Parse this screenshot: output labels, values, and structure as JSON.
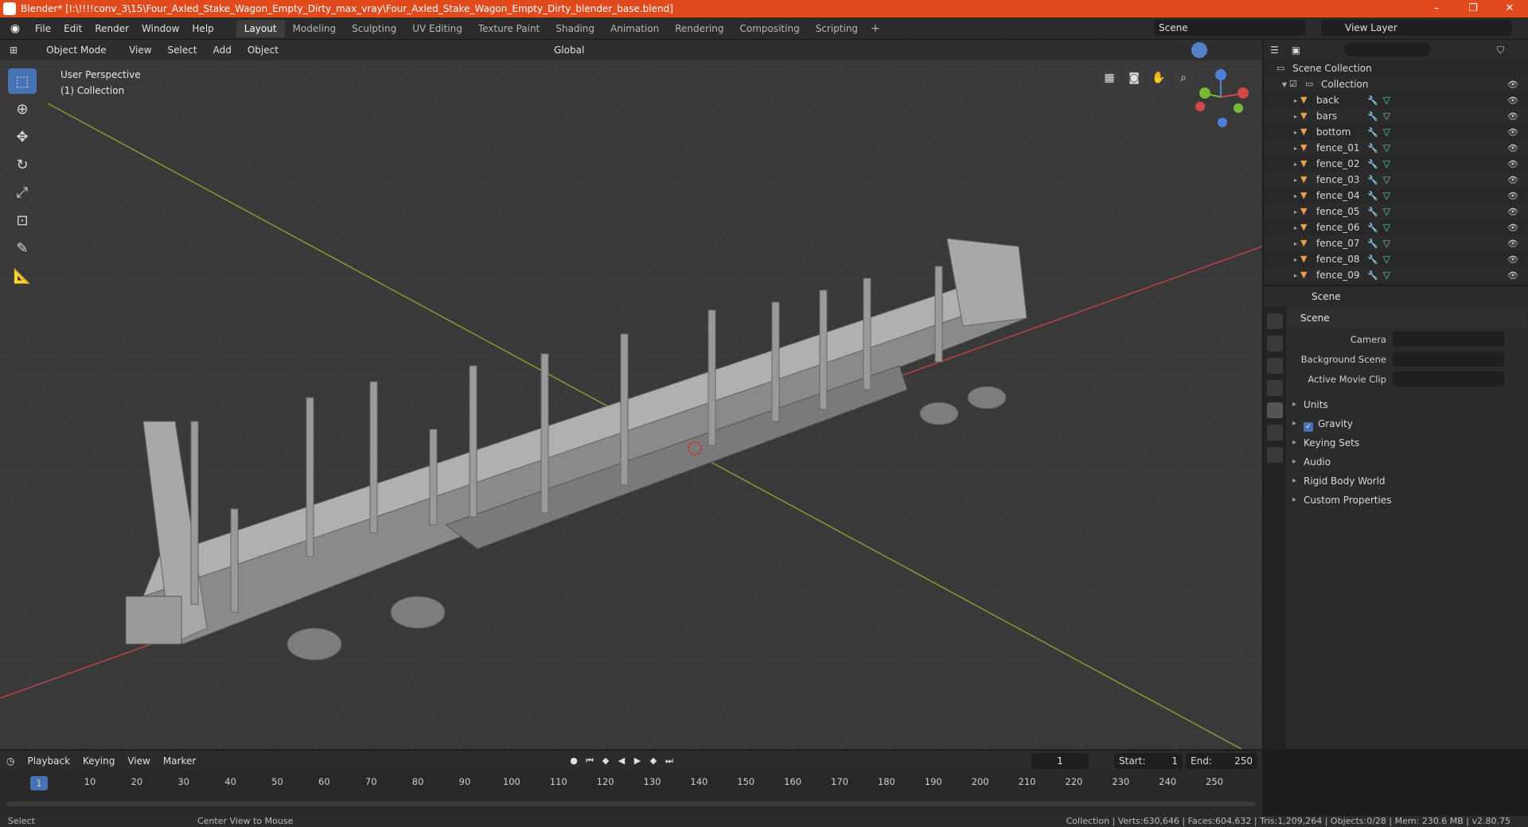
{
  "window": {
    "title": "Blender* [I:\\!!!!conv_3\\15\\Four_Axled_Stake_Wagon_Empty_Dirty_max_vray\\Four_Axled_Stake_Wagon_Empty_Dirty_blender_base.blend]",
    "minimize": "–",
    "maximize": "❐",
    "close": "✕"
  },
  "menu": [
    "File",
    "Edit",
    "Render",
    "Window",
    "Help"
  ],
  "workspaces": [
    "Layout",
    "Modeling",
    "Sculpting",
    "UV Editing",
    "Texture Paint",
    "Shading",
    "Animation",
    "Rendering",
    "Compositing",
    "Scripting"
  ],
  "active_workspace": "Layout",
  "scene_name": "Scene",
  "view_layer": "View Layer",
  "viewport": {
    "mode": "Object Mode",
    "menus": [
      "View",
      "Select",
      "Add",
      "Object"
    ],
    "orientation": "Global",
    "perspective": "User Perspective",
    "collection": "(1) Collection"
  },
  "outliner": {
    "root": "Scene Collection",
    "collection": "Collection",
    "items": [
      "back",
      "bars",
      "bottom",
      "fence_01",
      "fence_02",
      "fence_03",
      "fence_04",
      "fence_05",
      "fence_06",
      "fence_07",
      "fence_08",
      "fence_09"
    ]
  },
  "properties": {
    "header": "Scene",
    "panel": "Scene",
    "fields": [
      {
        "label": "Camera"
      },
      {
        "label": "Background Scene"
      },
      {
        "label": "Active Movie Clip"
      }
    ],
    "subpanels": [
      "Units",
      "Gravity",
      "Keying Sets",
      "Audio",
      "Rigid Body World",
      "Custom Properties"
    ],
    "gravity_checked": true
  },
  "timeline": {
    "menus": [
      "Playback",
      "Keying",
      "View",
      "Marker"
    ],
    "current_frame": "1",
    "start_label": "Start:",
    "start": "1",
    "end_label": "End:",
    "end": "250",
    "ticks": [
      "1",
      "10",
      "20",
      "30",
      "40",
      "50",
      "60",
      "70",
      "80",
      "90",
      "100",
      "110",
      "120",
      "130",
      "140",
      "150",
      "160",
      "170",
      "180",
      "190",
      "200",
      "210",
      "220",
      "230",
      "240",
      "250"
    ]
  },
  "status": {
    "left": "Select",
    "mid": "Center View to Mouse",
    "stats": "Collection | Verts:630,646 | Faces:604,632 | Tris:1,209,264 | Objects:0/28 | Mem: 230.6 MB | v2.80.75"
  },
  "colors": {
    "accent": "#4772b3",
    "titlebar": "#e04a1c",
    "axis_x": "#c9414a",
    "axis_y": "#8ab83a"
  }
}
